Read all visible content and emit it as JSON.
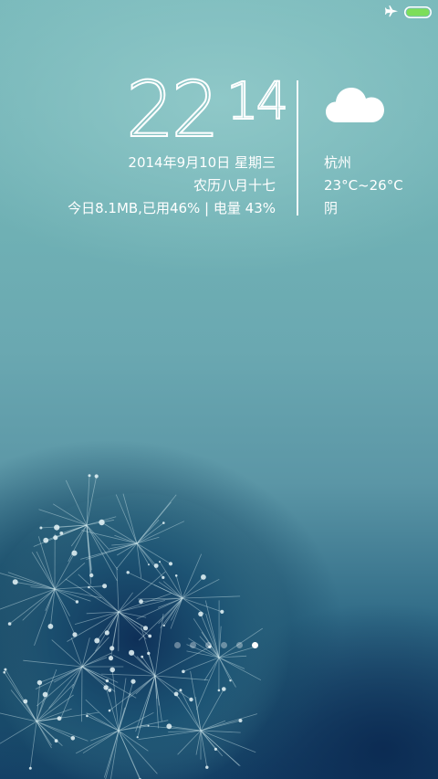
{
  "status_bar": {
    "airplane_mode_icon": "airplane-icon",
    "battery_icon": "battery-icon",
    "battery_color": "#7dde5a"
  },
  "clock": {
    "hour": "22",
    "minute": "14"
  },
  "date": {
    "gregorian": "2014年9月10日  星期三",
    "lunar": "农历八月十七",
    "usage": "今日8.1MB,已用46% | 电量 43%"
  },
  "weather": {
    "icon": "cloud-icon",
    "city": "杭州",
    "temperature": "23°C~26°C",
    "condition": "阴"
  },
  "page_indicator": {
    "total": 6,
    "active_index": 5
  }
}
